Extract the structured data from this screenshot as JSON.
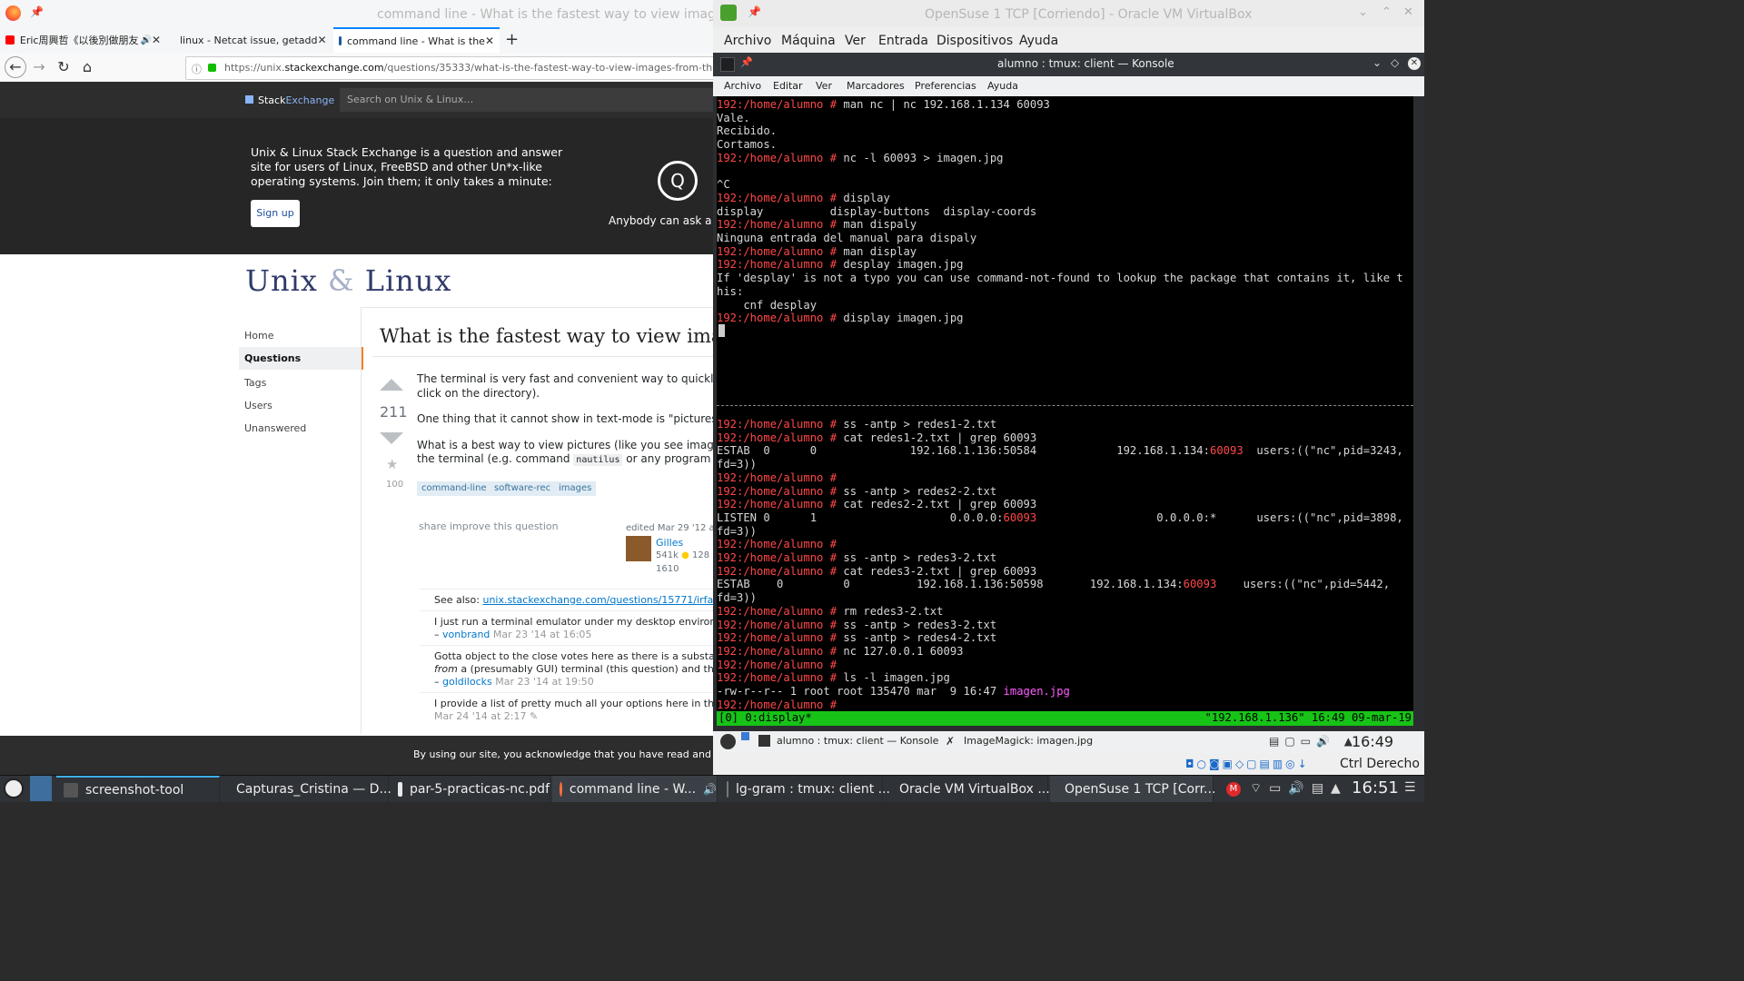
{
  "firefox": {
    "window_title": "command line - What is the fastest way to view images from",
    "tabs": [
      {
        "label": "Eric周興哲《以後別做朋友",
        "close": "✕"
      },
      {
        "label": "linux - Netcat issue, getadd",
        "close": "✕"
      },
      {
        "label": "command line - What is the",
        "close": "✕"
      }
    ],
    "new_tab": "+",
    "url_prefix": "https://unix.",
    "url_domain": "stackexchange.com",
    "url_path": "/questions/35333/what-is-the-fastest-way-to-view-images-from-the-terminal",
    "se": {
      "logo_a": "Stack",
      "logo_b": "Exchange",
      "search_placeholder": "Search on Unix & Linux…",
      "hero_text": "Unix & Linux Stack Exchange is a question and answer site for users of Linux, FreeBSD and other Un*x-like operating systems. Join them; it only takes a minute:",
      "signup": "Sign up",
      "anybody": "Anybody can ask a q"
    },
    "site_logo_a": "Unix ",
    "site_logo_amp": "&",
    "site_logo_b": " Linux",
    "left_nav": [
      "Home",
      "Questions",
      "Tags",
      "Users",
      "Unanswered"
    ],
    "question": {
      "title": "What is the fastest way to view image",
      "votes": "211",
      "favorites": "100",
      "body1a": "The terminal is very fast and convenient way to quickly acces",
      "body1b": "click on the directory).",
      "body2": "One thing that it cannot show in text-mode is \"pictures\".",
      "body3a": "What is a best way to view pictures (like you see images thur",
      "body3b_pre": "the terminal (e.g. command ",
      "body3b_code": "nautilus",
      "body3b_post": " or any program - but s",
      "tags": [
        "command-line",
        "software-rec",
        "images"
      ],
      "share": "share  improve this question",
      "edited": "edited Mar 29 '12 at 2",
      "user": "Gilles",
      "rep": "541k",
      "gold": "●",
      "silver_count": "128",
      "bronze_count": "1610"
    },
    "comments": [
      {
        "text": "See also: ",
        "link": "unix.stackexchange.com/questions/15771/irfanview-alt"
      },
      {
        "text": "I just run a terminal emulator under my desktop enviroment. So y",
        "dash": "– ",
        "user": "vonbrand",
        "meta": " Mar 23 '14 at 16:05"
      },
      {
        "text": "Gotta object to the close votes here as there is a substantial diff",
        "text2_em": "from",
        "text2": " a (presumably GUI) terminal (this question) and the need to",
        "dash": "– ",
        "user": "goldilocks",
        "meta": " Mar 23 '14 at 19:50"
      },
      {
        "text": "I provide a list of pretty much all your options here in this Q&A: ",
        "link": "h",
        "meta": "Mar 24 '14 at 2:17 ✎"
      }
    ],
    "cookie": "By using our site, you acknowledge that you have read and understan"
  },
  "vbox": {
    "window_title": "OpenSuse 1 TCP [Corriendo] - Oracle VM VirtualBox",
    "menu": [
      "Archivo",
      "Máquina",
      "Ver",
      "Entrada",
      "Dispositivos",
      "Ayuda"
    ],
    "konsole_title": "alumno : tmux: client — Konsole",
    "konsole_menu": [
      "Archivo",
      "Editar",
      "Ver",
      "Marcadores",
      "Preferencias",
      "Ayuda"
    ],
    "prompt": "192:/home/alumno #",
    "term_top": [
      {
        "p": true,
        "t": " man nc | nc 192.168.1.134 60093"
      },
      {
        "t": "Vale."
      },
      {
        "t": "Recibido."
      },
      {
        "t": "Cortamos."
      },
      {
        "p": true,
        "t": " nc -l 60093 > imagen.jpg"
      },
      {
        "t": ""
      },
      {
        "t": "^C"
      },
      {
        "p": true,
        "t": " display"
      },
      {
        "t": "display          display-buttons  display-coords"
      },
      {
        "p": true,
        "t": " man dispaly"
      },
      {
        "t": "Ninguna entrada del manual para dispaly"
      },
      {
        "p": true,
        "t": " man display"
      },
      {
        "p": true,
        "t": " desplay imagen.jpg"
      },
      {
        "t": "If 'desplay' is not a typo you can use command-not-found to lookup the package that contains it, like t"
      },
      {
        "t": "his:"
      },
      {
        "t": "    cnf desplay"
      },
      {
        "p": true,
        "t": " display imagen.jpg"
      }
    ],
    "term_bottom": [
      {
        "p": true,
        "t": " ss -antp > redes1-2.txt"
      },
      {
        "p": true,
        "t": " cat redes1-2.txt | grep 60093"
      },
      {
        "t": "ESTAB  0      0              192.168.1.136:50584            192.168.1.134:",
        "h": "60093",
        "t2": "  users:((\"nc\",pid=3243,"
      },
      {
        "t": "fd=3))"
      },
      {
        "p": true,
        "t": ""
      },
      {
        "p": true,
        "t": " ss -antp > redes2-2.txt"
      },
      {
        "p": true,
        "t": " cat redes2-2.txt | grep 60093"
      },
      {
        "t": "LISTEN 0      1                    0.0.0.0:",
        "h": "60093",
        "t2": "                  0.0.0.0:*      users:((\"nc\",pid=3898,"
      },
      {
        "t": "fd=3))"
      },
      {
        "p": true,
        "t": ""
      },
      {
        "p": true,
        "t": " ss -antp > redes3-2.txt"
      },
      {
        "p": true,
        "t": " cat redes3-2.txt | grep 60093"
      },
      {
        "t": "ESTAB    0         0          192.168.1.136:50598       192.168.1.134:",
        "h": "60093",
        "t2": "    users:((\"nc\",pid=5442,"
      },
      {
        "t": "fd=3))"
      },
      {
        "p": true,
        "t": " rm redes3-2.txt"
      },
      {
        "p": true,
        "t": " ss -antp > redes3-2.txt"
      },
      {
        "p": true,
        "t": " ss -antp > redes4-2.txt"
      },
      {
        "p": true,
        "t": " nc 127.0.0.1 60093"
      },
      {
        "p": true,
        "t": ""
      },
      {
        "p": true,
        "t": " ls -l imagen.jpg"
      },
      {
        "t": "-rw-r--r-- 1 root root 135470 mar  9 16:47 ",
        "m": "imagen.jpg"
      },
      {
        "p": true,
        "t": ""
      }
    ],
    "tmux_left": "[0] 0:display*",
    "tmux_right": "\"192.168.1.136\" 16:49 09-mar-19",
    "guest_tasks": [
      "alumno : tmux: client — Konsole",
      "ImageMagick: imagen.jpg"
    ],
    "guest_clock": "16:49",
    "host_key": "Ctrl Derecho"
  },
  "taskbar": {
    "items": [
      "screenshot-tool",
      "Capturas_Cristina — D...",
      "par-5-practicas-nc.pdf",
      "command line - W...",
      "lg-gram : tmux: client ...",
      "Oracle VM VirtualBox ...",
      "OpenSuse 1 TCP [Corr..."
    ],
    "clock": "16:51"
  }
}
